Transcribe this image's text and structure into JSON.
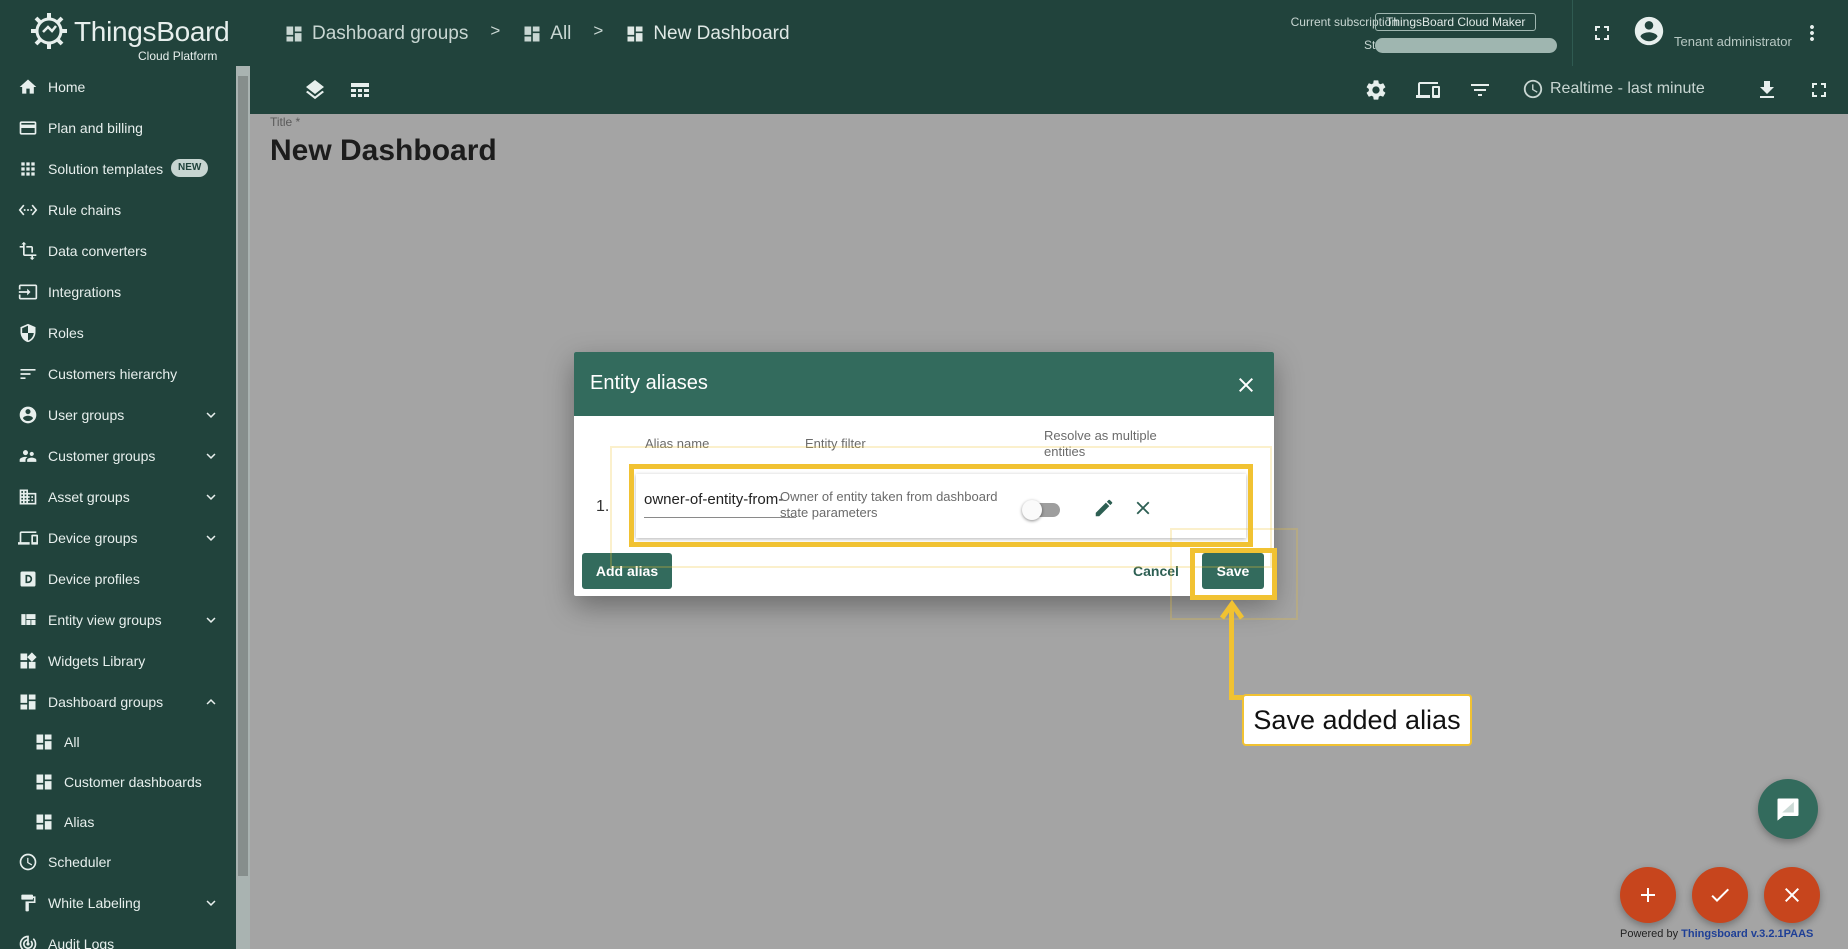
{
  "header": {
    "logo_name": "ThingsBoard",
    "logo_sub": "Cloud Platform",
    "breadcrumbs": [
      "Dashboard groups",
      "All",
      "New Dashboard"
    ],
    "breadcrumb_separator": ">",
    "subscription_label": "Current subscription",
    "subscription_value": "ThingsBoard Cloud Maker",
    "status_label": "Status",
    "user_role": "Tenant administrator"
  },
  "toolbar": {
    "realtime_label": "Realtime - last minute"
  },
  "sidebar": {
    "items": [
      {
        "label": "Home",
        "icon": "home-icon"
      },
      {
        "label": "Plan and billing",
        "icon": "credit-card-icon"
      },
      {
        "label": "Solution templates",
        "icon": "apps-grid-icon",
        "badge": "NEW"
      },
      {
        "label": "Rule chains",
        "icon": "settings-ethernet-icon"
      },
      {
        "label": "Data converters",
        "icon": "transform-icon"
      },
      {
        "label": "Integrations",
        "icon": "input-icon"
      },
      {
        "label": "Roles",
        "icon": "shield-icon"
      },
      {
        "label": "Customers hierarchy",
        "icon": "sort-icon"
      },
      {
        "label": "User groups",
        "icon": "account-circle-icon",
        "expand": "down"
      },
      {
        "label": "Customer groups",
        "icon": "supervisor-icon",
        "expand": "down"
      },
      {
        "label": "Asset groups",
        "icon": "domain-icon",
        "expand": "down"
      },
      {
        "label": "Device groups",
        "icon": "devices-icon",
        "expand": "down"
      },
      {
        "label": "Device profiles",
        "icon": "device-profile-icon"
      },
      {
        "label": "Entity view groups",
        "icon": "view-quilt-icon",
        "expand": "down"
      },
      {
        "label": "Widgets Library",
        "icon": "widgets-icon"
      },
      {
        "label": "Dashboard groups",
        "icon": "dashboard-icon",
        "expand": "up"
      },
      {
        "label": "All",
        "icon": "dashboard-icon",
        "sub": true
      },
      {
        "label": "Customer dashboards",
        "icon": "dashboard-icon",
        "sub": true
      },
      {
        "label": "Alias",
        "icon": "dashboard-icon",
        "sub": true
      },
      {
        "label": "Scheduler",
        "icon": "schedule-icon"
      },
      {
        "label": "White Labeling",
        "icon": "format-paint-icon",
        "expand": "down"
      },
      {
        "label": "Audit Logs",
        "icon": "track-changes-icon"
      }
    ]
  },
  "dashboard": {
    "title_label": "Title *",
    "title": "New Dashboard"
  },
  "dialog": {
    "title": "Entity aliases",
    "columns": {
      "alias_name": "Alias name",
      "entity_filter": "Entity filter",
      "resolve_multiple": "Resolve as multiple entities"
    },
    "rows": [
      {
        "index": "1.",
        "alias_name": "owner-of-entity-from-",
        "entity_filter": "Owner of entity taken from dashboard state parameters",
        "resolve_multiple": false
      }
    ],
    "add_label": "Add alias",
    "cancel_label": "Cancel",
    "save_label": "Save"
  },
  "tutorial": {
    "callout": "Save added alias",
    "highlight_color": "#f1c232"
  },
  "footer": {
    "powered_by": "Powered by",
    "powered_link": "Thingsboard v.3.2.1PAAS"
  },
  "colors": {
    "primary": "#21433c",
    "accent": "#336b5d",
    "fab": "#c7451d"
  }
}
